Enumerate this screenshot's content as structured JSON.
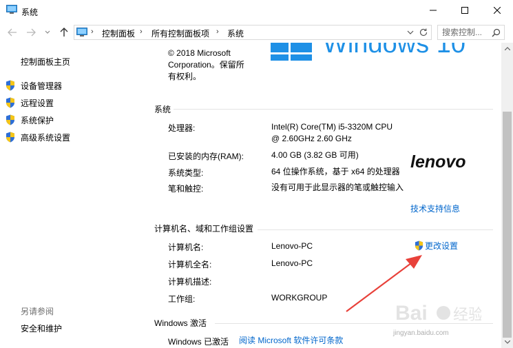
{
  "window": {
    "title": "系统",
    "minimize_icon": "minimize-icon",
    "maximize_icon": "maximize-icon",
    "close_icon": "close-icon"
  },
  "address_bar": {
    "breadcrumbs": [
      "控制面板",
      "所有控制面板项",
      "系统"
    ],
    "separator": "›"
  },
  "search": {
    "placeholder": "搜索控制..."
  },
  "sidebar": {
    "home_link": "控制面板主页",
    "items": [
      {
        "label": "设备管理器",
        "icon": "shield-icon"
      },
      {
        "label": "远程设置",
        "icon": "shield-icon"
      },
      {
        "label": "系统保护",
        "icon": "shield-icon"
      },
      {
        "label": "高级系统设置",
        "icon": "shield-icon"
      }
    ],
    "see_also_label": "另请参阅",
    "see_also_link": "安全和维护"
  },
  "main": {
    "copyright_lines": [
      "© 2018 Microsoft",
      "Corporation。保留所",
      "有权利。"
    ],
    "windows_logo_text": "Windows 10",
    "system_section": {
      "heading": "系统",
      "rows": [
        {
          "label": "处理器:",
          "value_lines": [
            "Intel(R) Core(TM) i5-3320M CPU",
            "@ 2.60GHz   2.60 GHz"
          ]
        },
        {
          "label": "已安装的内存(RAM):",
          "value_lines": [
            "4.00 GB (3.82 GB 可用)"
          ]
        },
        {
          "label": "系统类型:",
          "value_lines": [
            "64 位操作系统，基于 x64 的处理器"
          ]
        },
        {
          "label": "笔和触控:",
          "value_lines": [
            "没有可用于此显示器的笔或触控输入"
          ]
        }
      ],
      "brand_logo": "lenovo",
      "support_link": "技术支持信息"
    },
    "computer_section": {
      "heading": "计算机名、域和工作组设置",
      "rows": [
        {
          "label": "计算机名:",
          "value": "Lenovo-PC"
        },
        {
          "label": "计算机全名:",
          "value": "Lenovo-PC"
        },
        {
          "label": "计算机描述:",
          "value": ""
        },
        {
          "label": "工作组:",
          "value": "WORKGROUP"
        }
      ],
      "change_settings_link": "更改设置"
    },
    "activation_section": {
      "heading": "Windows 激活",
      "status": "Windows 已激活",
      "license_link": "阅读 Microsoft 软件许可条款"
    }
  },
  "watermark": {
    "text": "jingyan.baidu.com"
  },
  "colors": {
    "link": "#0066cc",
    "annotation_arrow": "#e8413a",
    "win_logo": "#1e90e6"
  }
}
